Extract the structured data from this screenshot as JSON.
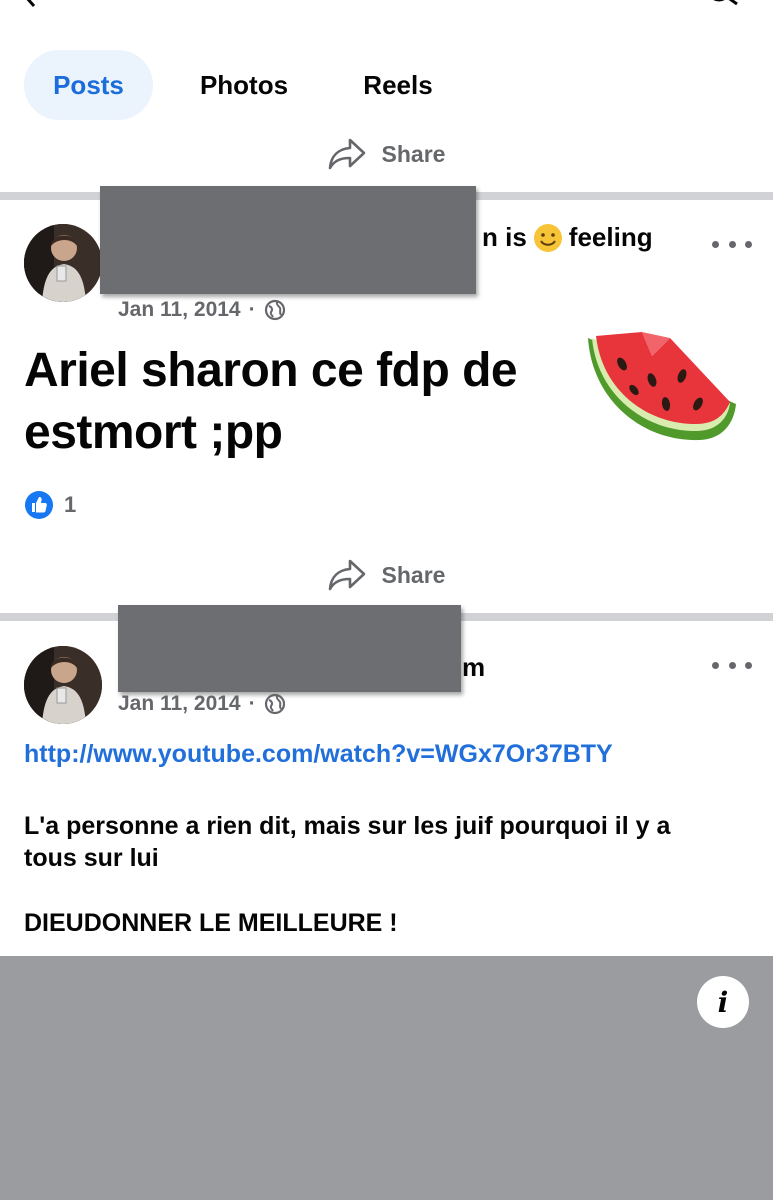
{
  "tabs": [
    {
      "label": "Posts",
      "active": true
    },
    {
      "label": "Photos",
      "active": false
    },
    {
      "label": "Reels",
      "active": false
    }
  ],
  "share_label": "Share",
  "posts": [
    {
      "header_visible_suffix": "n is",
      "feeling_text": "feeling",
      "date": "Jan 11, 2014",
      "separator": "·",
      "audience_icon": "globe-icon",
      "text_line1": "Ariel sharon ce fdp de",
      "text_line2": "estmort ;pp",
      "emoji": "watermelon",
      "reaction_count": "1"
    },
    {
      "header_visible_suffix": "m",
      "date": "Jan 11, 2014",
      "separator": "·",
      "audience_icon": "globe-icon",
      "link": "http://www.youtube.com/watch?v=WGx7Or37BTY",
      "paragraph1_line1": "L'a personne a rien dit, mais sur les juif pourquoi il y a",
      "paragraph1_line2": "tous sur lui",
      "paragraph2": "DIEUDONNER LE MEILLEURE !",
      "info_label": "i"
    }
  ],
  "colors": {
    "accent": "#1b6ddc",
    "link": "#216fdb",
    "secondary_text": "#65676b",
    "divider": "#d0d2d6",
    "redaction": "#6c6e72",
    "media_placeholder": "#9a9c9f"
  }
}
